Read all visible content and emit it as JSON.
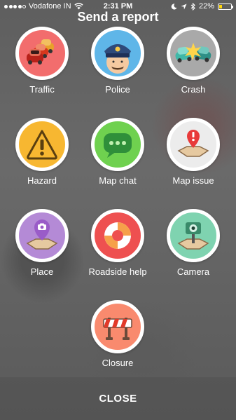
{
  "status_bar": {
    "carrier": "Vodafone IN",
    "time": "2:31 PM",
    "battery": "22%",
    "battery_level": 0.22,
    "icons": [
      "signal-icon",
      "wifi-icon",
      "moon-icon",
      "location-arrow-icon",
      "bluetooth-icon",
      "battery-icon"
    ]
  },
  "title": "Send a report",
  "reports": [
    {
      "label": "Traffic",
      "color": "#f26d6d",
      "icon": "traffic-cars-icon"
    },
    {
      "label": "Police",
      "color": "#5fb6e8",
      "icon": "police-officer-icon"
    },
    {
      "label": "Crash",
      "color": "#a9a9a9",
      "icon": "crash-cars-icon"
    },
    {
      "label": "Hazard",
      "color": "#f7b731",
      "icon": "hazard-warning-icon"
    },
    {
      "label": "Map chat",
      "color": "#6fd14f",
      "icon": "chat-bubble-icon"
    },
    {
      "label": "Map issue",
      "color": "#ececec",
      "icon": "map-issue-pin-icon"
    },
    {
      "label": "Place",
      "color": "#b48ad6",
      "icon": "place-camera-pin-icon"
    },
    {
      "label": "Roadside help",
      "color": "#ee5050",
      "icon": "lifebuoy-icon"
    },
    {
      "label": "Camera",
      "color": "#7fd3b0",
      "icon": "speed-camera-icon"
    },
    {
      "label": "Closure",
      "color": "#f98a6e",
      "icon": "road-barrier-icon"
    }
  ],
  "close_label": "CLOSE"
}
